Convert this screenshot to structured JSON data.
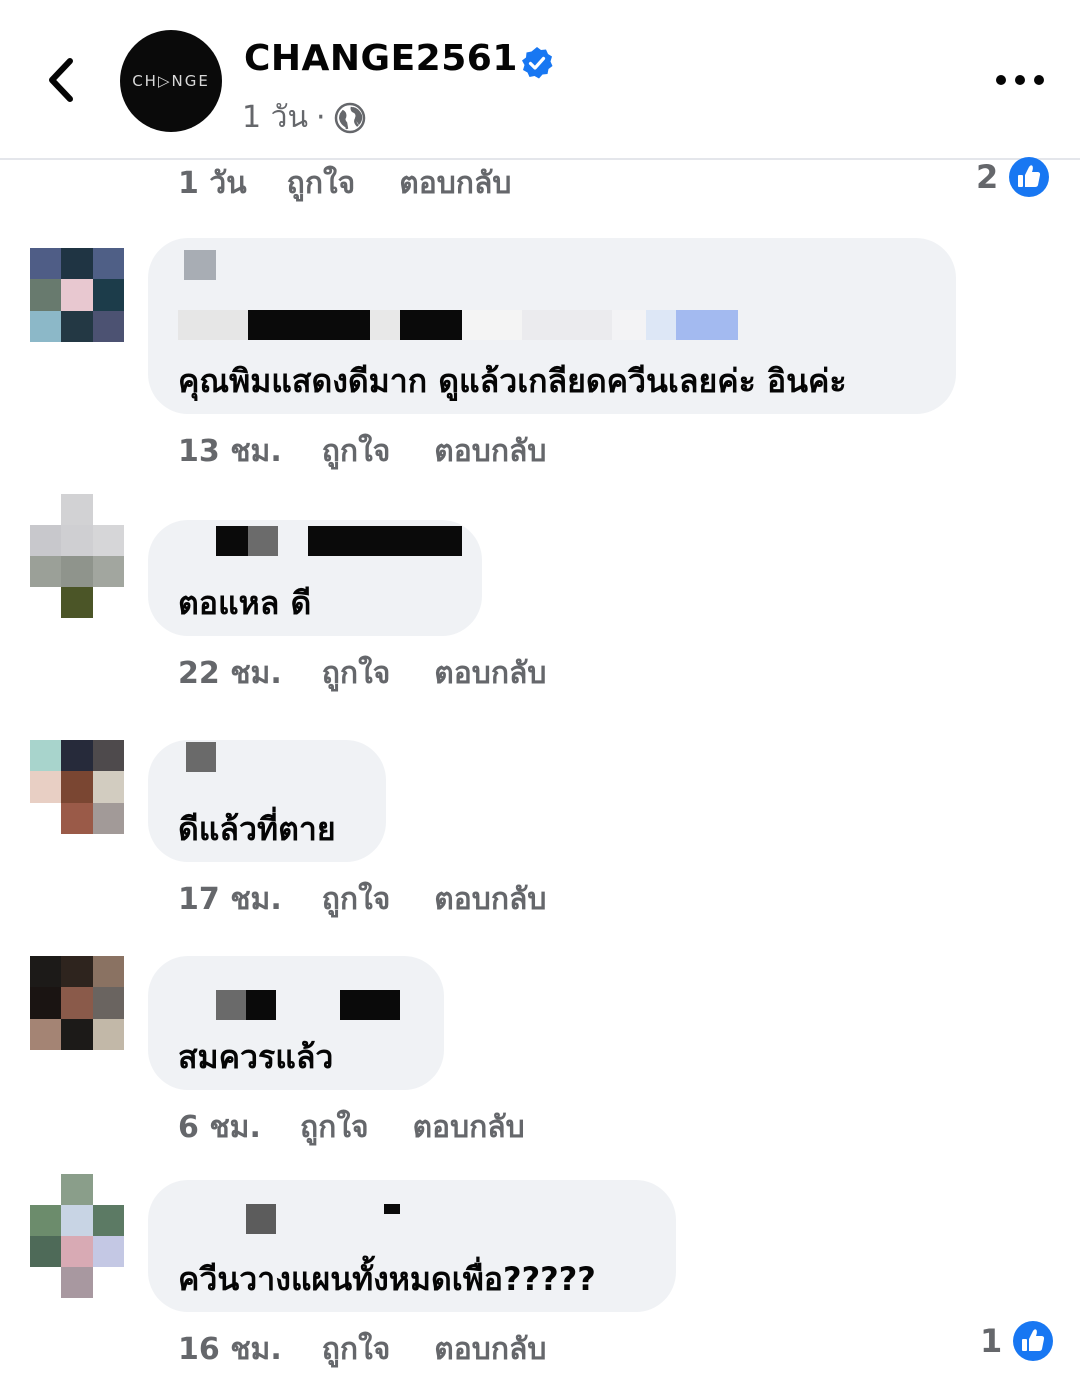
{
  "header": {
    "page_name": "CHANGE2561",
    "logo_text": "CH▷NGE",
    "post_time": "1 วัน",
    "separator": "·"
  },
  "top_actions": {
    "time": "1 วัน",
    "like": "ถูกใจ",
    "reply": "ตอบกลับ",
    "reaction_count": "2"
  },
  "comments": [
    {
      "text": "คุณพิมแสดงดีมาก ดูแล้วเกลียดควีนเลยค่ะ อินค่ะ",
      "time": "13 ชม.",
      "like": "ถูกใจ",
      "reply": "ตอบกลับ"
    },
    {
      "text": "ตอแหล ดี",
      "time": "22 ชม.",
      "like": "ถูกใจ",
      "reply": "ตอบกลับ"
    },
    {
      "text": "ดีแล้วที่ตาย",
      "time": "17 ชม.",
      "like": "ถูกใจ",
      "reply": "ตอบกลับ"
    },
    {
      "text": "สมควรแล้ว",
      "time": "6 ชม.",
      "like": "ถูกใจ",
      "reply": "ตอบกลับ"
    },
    {
      "text": "ควีนวางแผนทั้งหมดเพื่อ?????",
      "time": "16 ชม.",
      "like": "ถูกใจ",
      "reply": "ตอบกลับ",
      "reaction_count": "1"
    }
  ],
  "colors": {
    "verified": "#1877f2",
    "like_blue": "#1877f2",
    "bubble_bg": "#f0f2f5",
    "meta_gray": "#65676b"
  }
}
